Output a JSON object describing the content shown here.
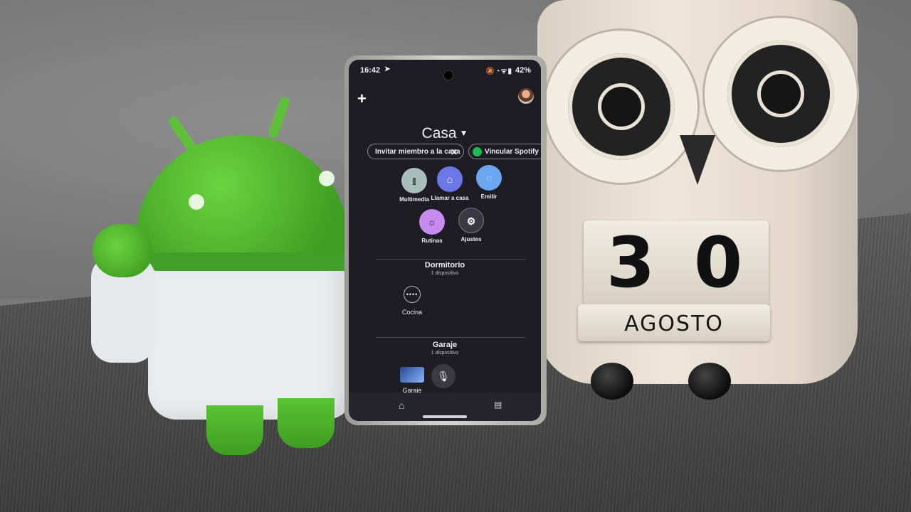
{
  "scene": {
    "description_colors": {
      "android_green": "#4cb52c",
      "owl_wood": "#e9dfd1",
      "phone_screen_bg": "#1f1d24"
    }
  },
  "calendar": {
    "day": "30",
    "day_digit_1": "3",
    "day_digit_2": "0",
    "month": "AGOSTO"
  },
  "phone": {
    "status": {
      "time": "16:42",
      "send_icon": "➤",
      "icons": "🔕◔ᯤ▮",
      "battery": "42%"
    },
    "plus_icon": "+",
    "title": "Casa",
    "title_caret": "▼",
    "chips": {
      "invite_label": "Invitar miembro a la casa",
      "invite_close": "✕",
      "spotify_label": "Vincular Spotify"
    },
    "actions": [
      {
        "label": "Multimedia",
        "icon": "⫾",
        "color": "#a9bdbb"
      },
      {
        "label": "Llamar a casa",
        "icon": "⌂",
        "color": "#6c77e8"
      },
      {
        "label": "Emitir",
        "icon": "◌",
        "color": "#6aa7f0"
      },
      {
        "label": "Rutinas",
        "icon": "☼",
        "color": "#c78bf0"
      },
      {
        "label": "Ajustes",
        "icon": "⚙",
        "color": "#3a3842"
      }
    ],
    "rooms": [
      {
        "name": "Dormitorio",
        "subtitle": "1 dispositivo",
        "device": "Cocina",
        "device_icon": "••••"
      },
      {
        "name": "Garaje",
        "subtitle": "1 dispositivo",
        "device": "Garaje"
      }
    ],
    "mic_icon": "🎙",
    "nav": {
      "home_icon": "⌂",
      "feed_icon": "▤"
    }
  }
}
